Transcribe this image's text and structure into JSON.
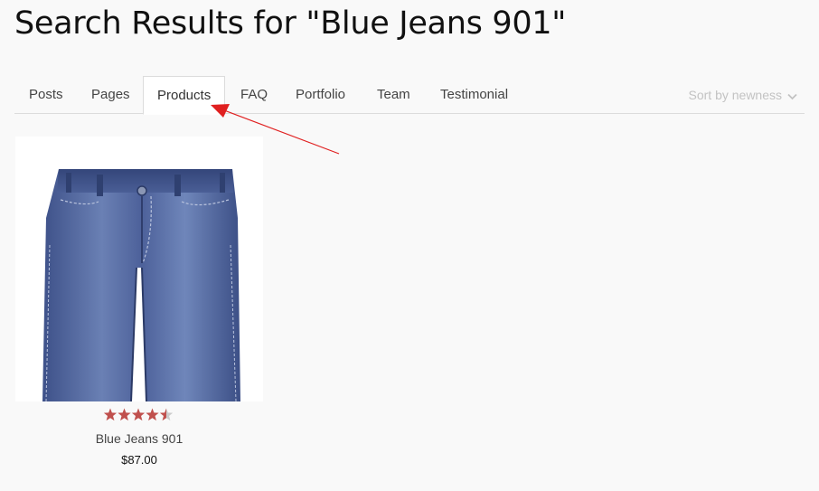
{
  "page": {
    "title": "Search Results for \"Blue Jeans 901\""
  },
  "tabs": [
    {
      "label": "Posts"
    },
    {
      "label": "Pages"
    },
    {
      "label": "Products",
      "active": true
    },
    {
      "label": "FAQ"
    },
    {
      "label": "Portfolio"
    },
    {
      "label": "Team"
    },
    {
      "label": "Testimonial"
    }
  ],
  "sort": {
    "selected": "Sort by newness",
    "icon": "chevron-down-icon"
  },
  "products": [
    {
      "name": "Blue Jeans 901",
      "price": "$87.00",
      "rating": 4.5,
      "rating_max": 5,
      "image_icon": "jeans-image"
    }
  ],
  "colors": {
    "star": "#c0504d",
    "star_empty": "#cccccc",
    "annotation": "#e02020",
    "denim": "#4a5f96"
  }
}
